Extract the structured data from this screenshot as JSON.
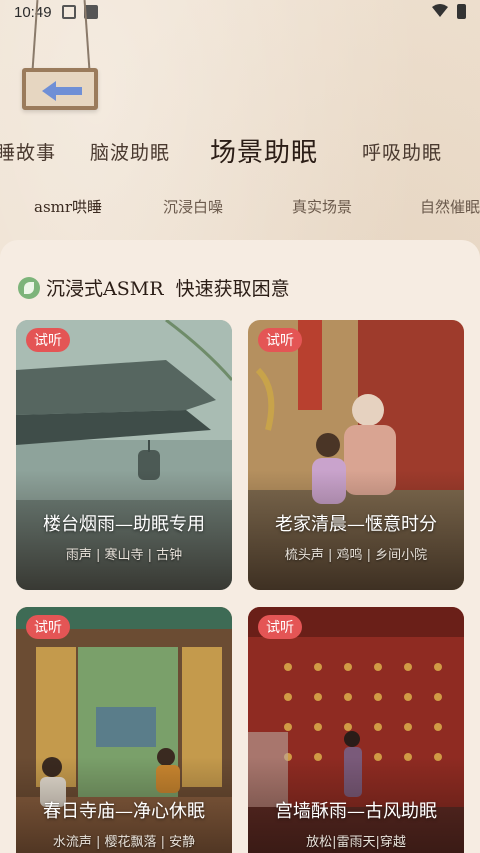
{
  "status_bar": {
    "time": "10:49"
  },
  "tabs": [
    {
      "label": "睡故事"
    },
    {
      "label": "脑波助眠"
    },
    {
      "label": "场景助眠"
    },
    {
      "label": "呼吸助眠"
    }
  ],
  "subtabs": [
    {
      "label": "asmr哄睡"
    },
    {
      "label": "沉浸白噪"
    },
    {
      "label": "真实场景"
    },
    {
      "label": "自然催眠"
    }
  ],
  "section": {
    "title": "沉浸式ASMR  快速获取困意"
  },
  "cards": [
    {
      "badge": "试听",
      "title": "楼台烟雨—助眠专用",
      "tags": "雨声 | 寒山寺 | 古钟"
    },
    {
      "badge": "试听",
      "title": "老家清晨—惬意时分",
      "tags": "梳头声 | 鸡鸣 | 乡间小院"
    },
    {
      "badge": "试听",
      "title": "春日寺庙—净心休眠",
      "tags": "水流声 | 樱花飘落 | 安静"
    },
    {
      "badge": "试听",
      "title": "宫墙酥雨—古风助眠",
      "tags": "放松|雷雨天|穿越"
    }
  ],
  "colors": {
    "accent": "#e45555",
    "highlight": "#ecaf91",
    "panel": "#f6ece2"
  }
}
